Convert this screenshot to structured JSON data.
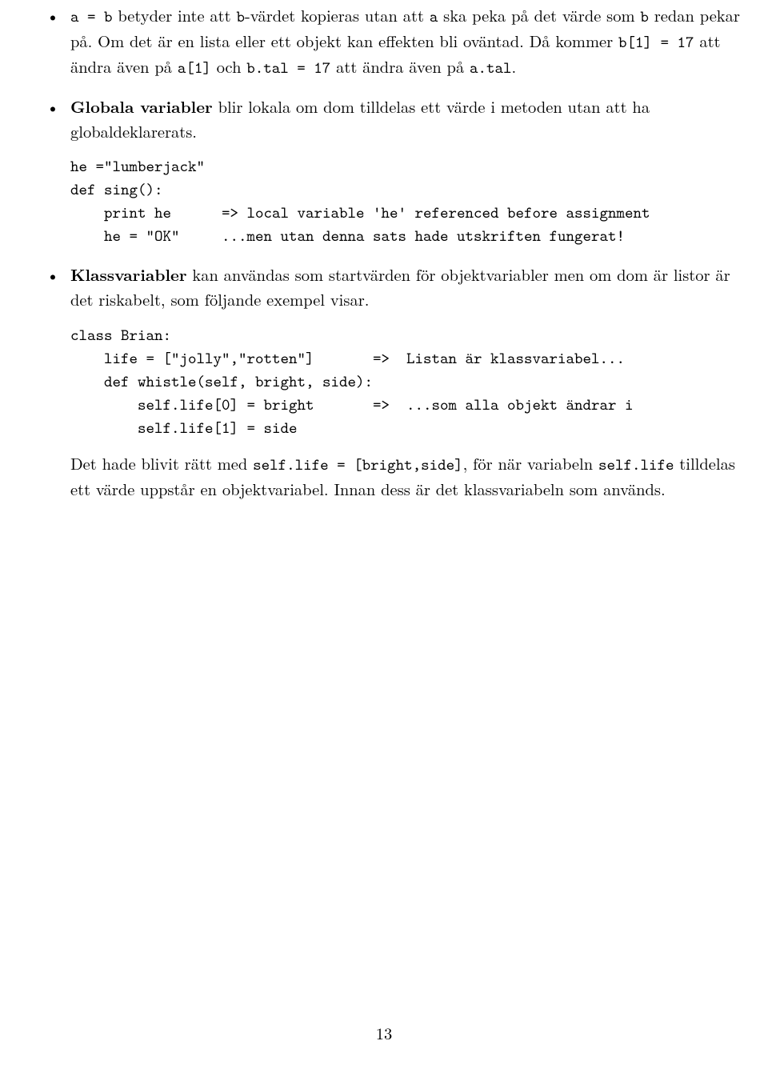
{
  "li1": {
    "p1_a": "a = b",
    "p1_b": " betyder inte att ",
    "p1_c": "b",
    "p1_d": "-värdet kopieras utan att ",
    "p1_e": "a",
    "p1_f": " ska peka på det värde som ",
    "p1_g": "b",
    "p1_h": " redan pekar på. Om det är en lista eller ett objekt kan effekten bli oväntad. Då kommer ",
    "p1_i": "b[1] = 17",
    "p1_j": " att ändra även på ",
    "p1_k": "a[1]",
    "p1_l": " och ",
    "p1_m": "b.tal = 17",
    "p1_n": " att ändra även på ",
    "p1_o": "a.tal",
    "p1_p": "."
  },
  "li2": {
    "p_a": "Globala variabler",
    "p_b": " blir lokala om dom tilldelas ett värde i metoden utan att ha globaldeklarerats.",
    "code": "he =\"lumberjack\"\ndef sing():\n    print he      => local variable 'he' referenced before assignment\n    he = \"OK\"     ...men utan denna sats hade utskriften fungerat!"
  },
  "li3": {
    "p_a": "Klassvariabler",
    "p_b": " kan användas som startvärden för objektvariabler men om dom är listor är det riskabelt, som följande exempel visar.",
    "code": "class Brian:\n    life = [\"jolly\",\"rotten\"]       =>  Listan är klassvariabel...\n    def whistle(self, bright, side):\n        self.life[0] = bright       =>  ...som alla objekt ändrar i\n        self.life[1] = side",
    "after_a": "Det hade blivit rätt med ",
    "after_b": "self.life = [bright,side]",
    "after_c": ", för när variabeln ",
    "after_d": "self.life",
    "after_e": " tilldelas ett värde uppstår en objektvariabel. Innan dess är det klassvariabeln som används."
  },
  "pagenum": "13"
}
